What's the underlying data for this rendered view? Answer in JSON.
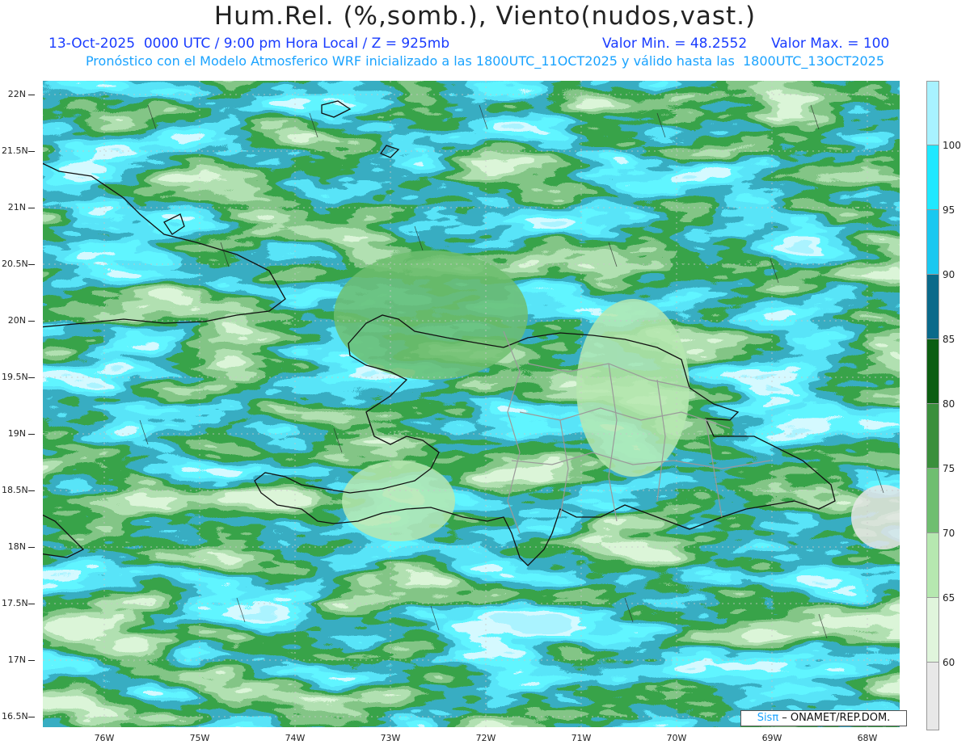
{
  "header": {
    "title": "Hum.Rel. (%,somb.), Viento(nudos,vast.)",
    "date_line": "13-Oct-2025  0000 UTC / 9:00 pm Hora Local / Z = 925mb",
    "value_min": "Valor Min. = 48.2552",
    "value_max": "Valor Max. = 100",
    "model_line": "Pronóstico con el Modelo Atmosferico WRF inicializado a las 1800UTC_11OCT2025 y válido hasta las  1800UTC_13OCT2025"
  },
  "axes": {
    "lat_labels": [
      "22N",
      "21.5N",
      "21N",
      "20.5N",
      "20N",
      "19.5N",
      "19N",
      "18.5N",
      "18N",
      "17.5N",
      "17N",
      "16.5N"
    ],
    "lon_labels": [
      "76W",
      "75W",
      "74W",
      "73W",
      "72W",
      "71W",
      "70W",
      "69W",
      "68W"
    ]
  },
  "colorbar": {
    "labels": [
      "100",
      "95",
      "90",
      "85",
      "80",
      "75",
      "70",
      "65",
      "60"
    ],
    "colors": [
      "#a8f2ff",
      "#1fe8ff",
      "#1ac8f0",
      "#0a6a8a",
      "#0b5e12",
      "#3a8f3c",
      "#6fbe70",
      "#b6e8b0",
      "#e8e8e8"
    ]
  },
  "credit": {
    "brand": "Sisπ",
    "text": " – ONAMET/REP.DOM."
  }
}
